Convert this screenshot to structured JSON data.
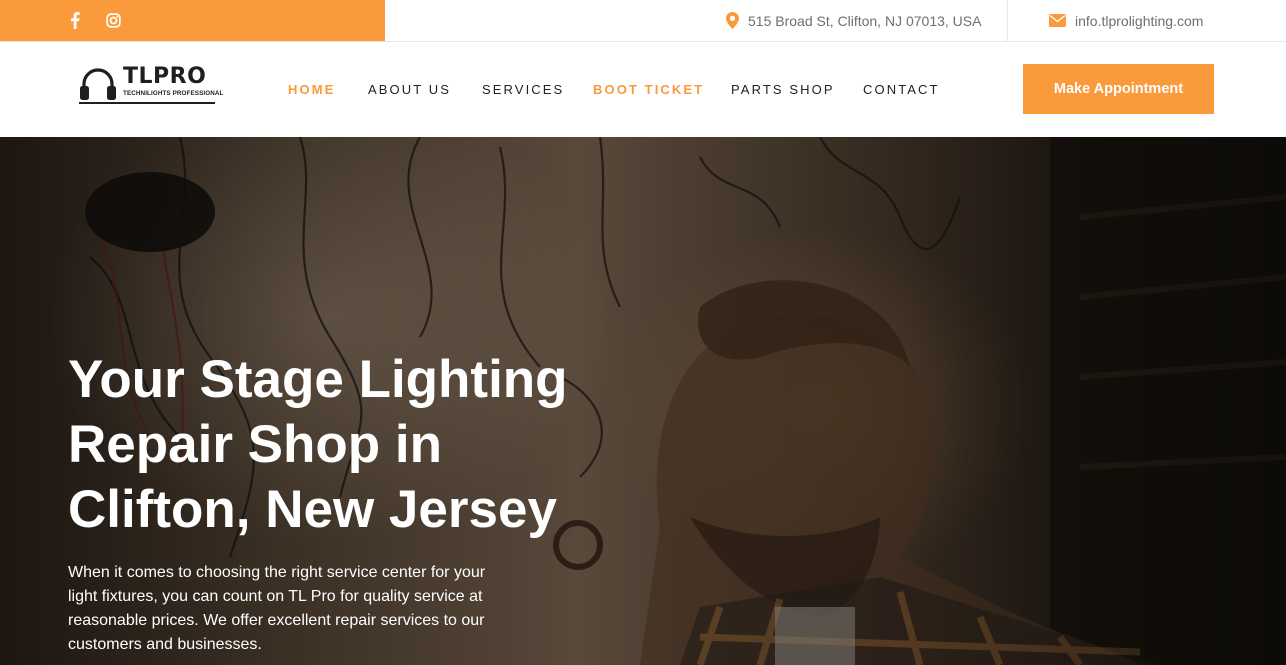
{
  "topbar": {
    "social": [
      {
        "icon": "facebook-icon"
      },
      {
        "icon": "instagram-icon"
      }
    ],
    "address": "515 Broad St, Clifton, NJ 07013, USA",
    "email": "info.tlprolighting.com",
    "accent_color": "#fb9a3a"
  },
  "logo": {
    "title": "TLPRO",
    "subtitle": "TECHNILIGHTS PROFESSIONAL",
    "icon": "headphones-icon"
  },
  "nav": {
    "items": [
      {
        "label": "HOME",
        "active": true
      },
      {
        "label": "ABOUT US",
        "active": false
      },
      {
        "label": "SERVICES",
        "active": false
      },
      {
        "label": "BOOT TICKET",
        "active": true
      },
      {
        "label": "PARTS SHOP",
        "active": false
      },
      {
        "label": "CONTACT",
        "active": false
      }
    ]
  },
  "cta": {
    "label": "Make Appointment"
  },
  "hero": {
    "title_lines": [
      "Your Stage Lighting",
      "Repair Shop in",
      "Clifton, New Jersey"
    ],
    "text": "When it comes to choosing the right service center for your light fixtures, you can count on TL Pro for quality service at reasonable prices. We offer excellent repair services to our customers and businesses."
  }
}
